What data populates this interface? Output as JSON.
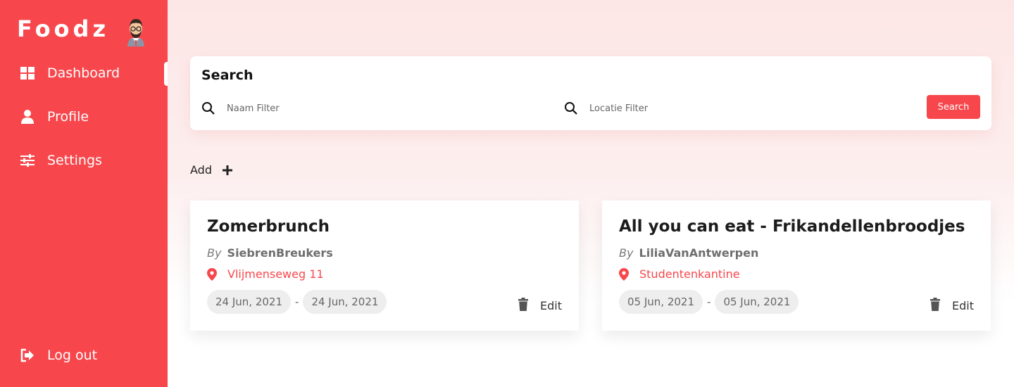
{
  "app": {
    "brand": "Foodz"
  },
  "sidebar": {
    "items": [
      {
        "label": "Dashboard",
        "icon": "dashboard-icon",
        "active": true
      },
      {
        "label": "Profile",
        "icon": "user-icon"
      },
      {
        "label": "Settings",
        "icon": "sliders-icon"
      }
    ],
    "logout": {
      "label": "Log out",
      "icon": "logout-icon"
    }
  },
  "search": {
    "title": "Search",
    "name_placeholder": "Naam Filter",
    "location_placeholder": "Locatie Filter",
    "button_label": "Search"
  },
  "add": {
    "label": "Add"
  },
  "events": [
    {
      "title": "Zomerbrunch",
      "by_label": "By",
      "author": "SiebrenBreukers",
      "location": "Vlijmenseweg 11",
      "start_date": "24 Jun, 2021",
      "separator": "-",
      "end_date": "24 Jun, 2021",
      "edit_label": "Edit"
    },
    {
      "title": "All you can eat - Frikandellenbroodjes",
      "by_label": "By",
      "author": "LiliaVanAntwerpen",
      "location": "Studentenkantine",
      "start_date": "05 Jun, 2021",
      "separator": "-",
      "end_date": "05 Jun, 2021",
      "edit_label": "Edit"
    }
  ],
  "colors": {
    "accent": "#f7474c",
    "background_tint": "#fde6e6"
  }
}
